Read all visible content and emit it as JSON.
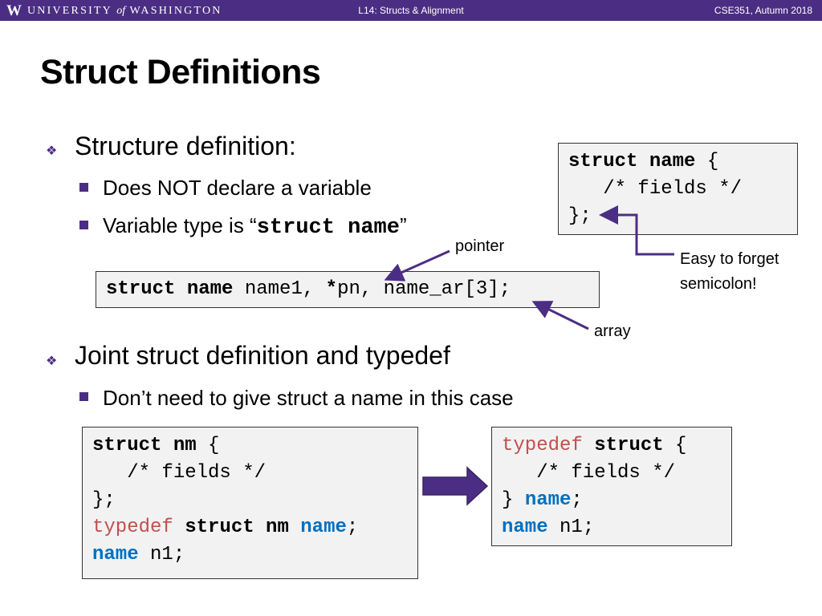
{
  "header": {
    "logo": "W",
    "university_pre": "UNIVERSITY",
    "university_of": "of",
    "university_post": "WASHINGTON",
    "lecture": "L14:  Structs & Alignment",
    "course": "CSE351, Autumn 2018"
  },
  "slide": {
    "title": "Struct Definitions",
    "bullet1": "Structure definition:",
    "sub1": "Does NOT declare a variable",
    "sub2_pre": "Variable type is “",
    "sub2_code": "struct name",
    "sub2_post": "”",
    "bullet2": "Joint struct definition and typedef",
    "sub3": "Don’t need to give struct a name in this case"
  },
  "code_def": {
    "l1_kw": "struct name",
    "l1_rest": " {",
    "l2": "   /* fields */",
    "l3": "};"
  },
  "code_decl": {
    "kw": "struct name",
    "mid1": " name1, ",
    "star": "*",
    "rest": "pn, name_ar[3];"
  },
  "code_joint": {
    "l1_kw": "struct nm",
    "l1_rest": " {",
    "l2": "   /* fields */",
    "l3": "};",
    "l4_typedef": "typedef",
    "l4_kw": " struct nm ",
    "l4_name": "name",
    "l4_end": ";",
    "l5_name": "name",
    "l5_rest": " n1;"
  },
  "code_typedef": {
    "l1_typedef": "typedef",
    "l1_kw": " struct",
    "l1_rest": " {",
    "l2": "   /* fields */",
    "l3_pre": "} ",
    "l3_name": "name",
    "l3_end": ";",
    "l4_name": "name",
    "l4_rest": " n1;"
  },
  "notes": {
    "pointer": "pointer",
    "array": "array",
    "semicolon_l1": "Easy to forget",
    "semicolon_l2": "semicolon!"
  },
  "colors": {
    "uw_purple": "#4b2e83",
    "typedef_red": "#c0504d",
    "name_blue": "#0070c0"
  }
}
